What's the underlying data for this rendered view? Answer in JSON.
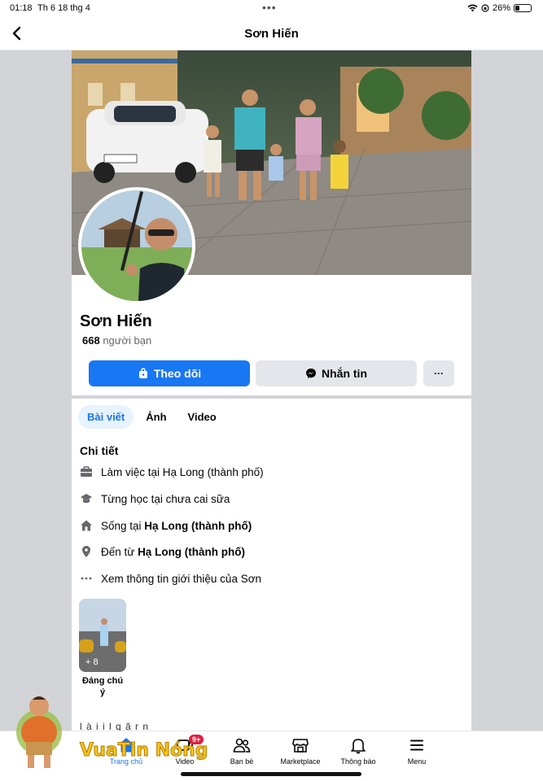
{
  "status_bar": {
    "time": "01:18",
    "date": "Th 6 18 thg 4",
    "battery": "26%",
    "battery_level": 0.26
  },
  "header": {
    "title": "Sơn Hiến",
    "back_icon": "chevron-left-icon"
  },
  "profile": {
    "name": "Sơn Hiến",
    "friend_count": "668",
    "friend_label": "người bạn",
    "follow_label": "Theo dõi",
    "message_label": "Nhắn tin",
    "more_label": "···"
  },
  "tabs": [
    {
      "label": "Bài viết",
      "active": true
    },
    {
      "label": "Ảnh",
      "active": false
    },
    {
      "label": "Video",
      "active": false
    }
  ],
  "details": {
    "title": "Chi tiết",
    "work": {
      "text": "Làm việc tại Hạ Long (thành phố)",
      "icon": "briefcase-icon"
    },
    "study": {
      "text": "Từng học tại chưa cai sữa",
      "icon": "graduation-cap-icon"
    },
    "lives_prefix": "Sống tại ",
    "lives_place": "Hạ Long (thành phố)",
    "from_prefix": "Đến từ ",
    "from_place": "Hạ Long (thành phố)",
    "more_info": "Xem thông tin giới thiệu của Sơn"
  },
  "featured": {
    "count_label": "+ 8",
    "label": "Đáng chú ý"
  },
  "partial_text": "l à  i i  l q  ặ  r n",
  "bottom_nav": {
    "home": "Trang chủ",
    "video": "Video",
    "video_badge": "9+",
    "friends": "Bạn bè",
    "marketplace": "Marketplace",
    "notifications": "Thông báo",
    "menu": "Menu"
  },
  "watermark": {
    "text": "VuaTin Nóng"
  },
  "colors": {
    "primary": "#1877f2",
    "secondary_button": "#e4e6eb",
    "badge": "#e41e3f"
  }
}
